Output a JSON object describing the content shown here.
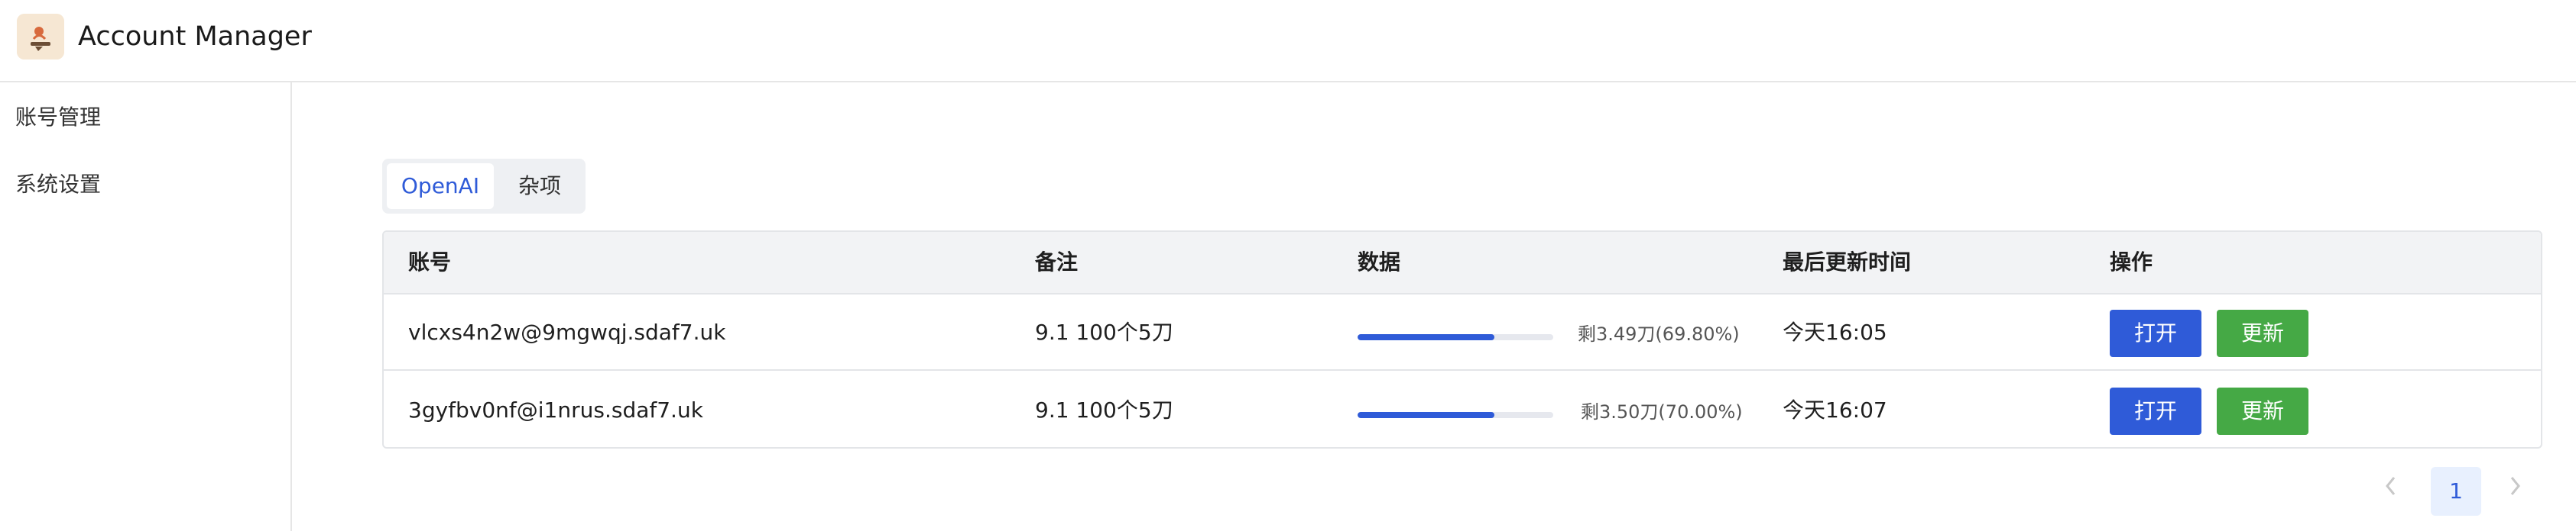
{
  "app": {
    "title": "Account Manager",
    "logo_icon": "app-logo-icon"
  },
  "sidebar": {
    "items": [
      {
        "label": "账号管理"
      },
      {
        "label": "系统设置"
      }
    ]
  },
  "tabs": [
    {
      "label": "OpenAI",
      "active": true
    },
    {
      "label": "杂项",
      "active": false
    }
  ],
  "table": {
    "headers": [
      "账号",
      "备注",
      "数据",
      "最后更新时间",
      "操作"
    ],
    "rows": [
      {
        "account": "vlcxs4n2w@9mgwqj.sdaf7.uk",
        "note": "9.1 100个5刀",
        "progress": 0.698,
        "progress_text": "剩3.49刀(69.80%)",
        "updated": "今天16:05",
        "open_label": "打开",
        "update_label": "更新"
      },
      {
        "account": "3gyfbv0nf@i1nrus.sdaf7.uk",
        "note": "9.1 100个5刀",
        "progress": 0.7,
        "progress_text": "剩3.50刀(70.00%)",
        "updated": "今天16:07",
        "open_label": "打开",
        "update_label": "更新"
      }
    ]
  },
  "pagination": {
    "prev_icon": "chevron-left-icon",
    "current_page": "1",
    "next_icon": "chevron-right-icon"
  },
  "colors": {
    "accent": "#2f5bd8",
    "success": "#45a945"
  }
}
